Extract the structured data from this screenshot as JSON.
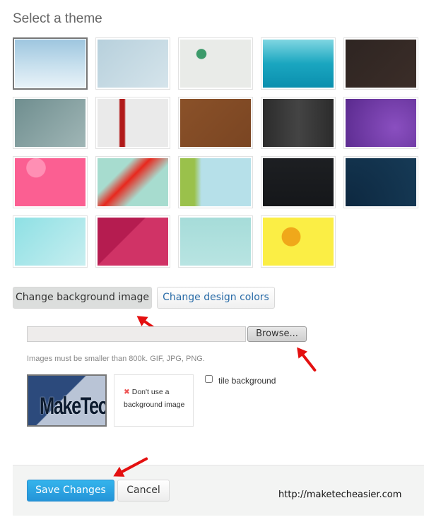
{
  "title": "Select a theme",
  "themes": [
    {
      "name": "clouds",
      "bg": "linear-gradient(#9ec6df,#c8e0ee 55%,#e8f2f8)",
      "selected": true
    },
    {
      "name": "tree",
      "bg": "linear-gradient(135deg,#b7d0dc,#d5e4eb)"
    },
    {
      "name": "vines",
      "bg": "radial-gradient(circle at 30% 30%,#3c9a6a 8%,transparent 9%),#e9ebe8"
    },
    {
      "name": "stars",
      "bg": "linear-gradient(#7fd6e2,#1aa6c0 50%,#0b8fae)"
    },
    {
      "name": "leaves-dark",
      "bg": "linear-gradient(135deg,#2e2522,#3b2d28)"
    },
    {
      "name": "foliage",
      "bg": "linear-gradient(135deg,#6f8e8f,#a0b6b6)"
    },
    {
      "name": "red-plant",
      "bg": "linear-gradient(90deg,#eaeaea 30%,#b11a1a 32%,#b11a1a 38%,#eaeaea 40%)"
    },
    {
      "name": "birds-brown",
      "bg": "linear-gradient(135deg,#8a5129,#7a4522)"
    },
    {
      "name": "charcoal",
      "bg": "linear-gradient(90deg,#2c2c2c,#444,#2c2c2c)"
    },
    {
      "name": "purple",
      "bg": "radial-gradient(circle at 70% 60%,#8a4fc0,#5a2a8e)"
    },
    {
      "name": "pink-flowers",
      "bg": "radial-gradient(circle at 30% 20%,#ff8fb4 15%,transparent 16%),#fb5f92"
    },
    {
      "name": "red-leaf",
      "bg": "linear-gradient(135deg,#a7dccf 30%,#e8281e 45%,#a7dccf 65%)"
    },
    {
      "name": "green-leaves",
      "bg": "linear-gradient(90deg,#9ac14b 20%,#b6e0e9 30%)"
    },
    {
      "name": "hexagon",
      "bg": "linear-gradient(#1d1f22,#15171a)"
    },
    {
      "name": "navy-rays",
      "bg": "radial-gradient(circle at 0 100%,#0d2840,#163a56)"
    },
    {
      "name": "cyan",
      "bg": "linear-gradient(135deg,#8ee0e4,#c7eef0)"
    },
    {
      "name": "crimson",
      "bg": "linear-gradient(135deg,#b51c50 40%,#d03366 41%)"
    },
    {
      "name": "birds-teal",
      "bg": "linear-gradient(#a6dcd9,#b8e4e2)"
    },
    {
      "name": "yellow-leaves",
      "bg": "radial-gradient(circle at 40% 40%,#f0a81a 18%,transparent 19%),#fbee45"
    }
  ],
  "tabs": {
    "background": "Change background image",
    "colors": "Change design colors"
  },
  "file": {
    "value": "",
    "browse": "Browse..."
  },
  "hint": "Images must be smaller than 800k. GIF, JPG, PNG.",
  "current_image_text": "MakeTec",
  "no_bg": {
    "icon": "✖",
    "label": "Don't use a background image"
  },
  "tile_bg": {
    "label": "tile background",
    "checked": false
  },
  "footer": {
    "save": "Save Changes",
    "cancel": "Cancel"
  },
  "watermark": "http://maketecheasier.com",
  "colors": {
    "accent": "#2ea3e3",
    "arrow": "#e41010"
  }
}
